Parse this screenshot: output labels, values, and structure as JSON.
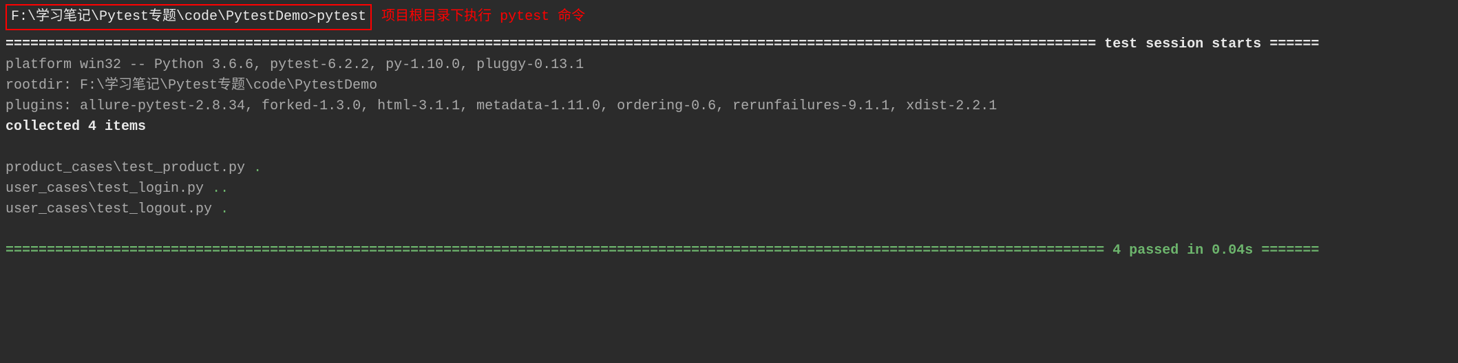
{
  "prompt": {
    "path": "F:\\学习笔记\\Pytest专题\\code\\PytestDemo>",
    "command": "pytest",
    "annotation": "项目根目录下执行 pytest 命令"
  },
  "session": {
    "header_prefix": "==================================================================================================================================== ",
    "header_text": "test session starts",
    "header_suffix": " ======",
    "platform": "platform win32 -- Python 3.6.6, pytest-6.2.2, py-1.10.0, pluggy-0.13.1",
    "rootdir": "rootdir: F:\\学习笔记\\Pytest专题\\code\\PytestDemo",
    "plugins": "plugins: allure-pytest-2.8.34, forked-1.3.0, html-3.1.1, metadata-1.11.0, ordering-0.6, rerunfailures-9.1.1, xdist-2.2.1",
    "collected": "collected 4 items"
  },
  "tests": {
    "line1_file": "product_cases\\test_product.py ",
    "line1_dots": ".",
    "line2_file": "user_cases\\test_login.py ",
    "line2_dots": "..",
    "line3_file": "user_cases\\test_logout.py ",
    "line3_dots": "."
  },
  "summary": {
    "prefix": "===================================================================================================================================== ",
    "text": "4 passed in 0.04s",
    "suffix": " ======="
  }
}
